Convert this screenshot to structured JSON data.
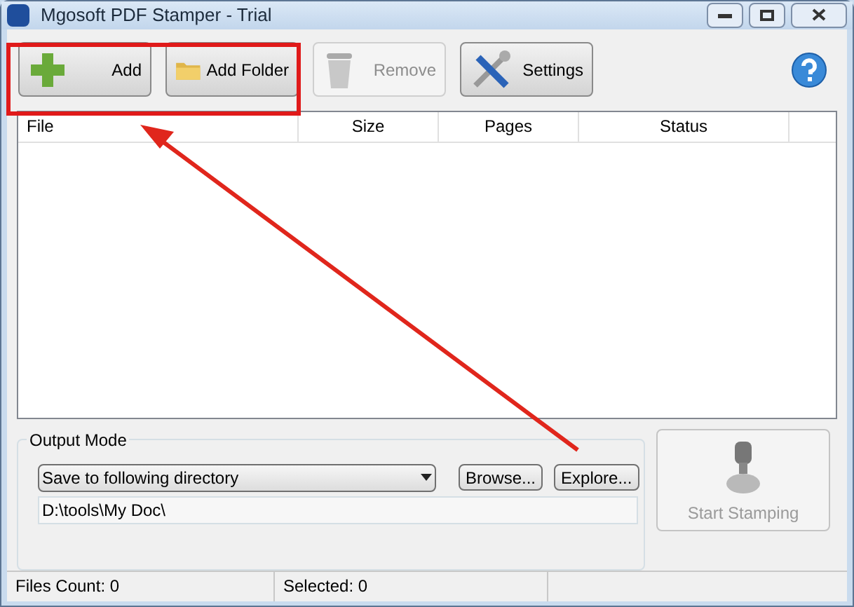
{
  "window": {
    "title": "Mgosoft PDF Stamper - Trial"
  },
  "toolbar": [
    {
      "label": "Add",
      "kind": "add",
      "disabled": false
    },
    {
      "label": "Add Folder",
      "kind": "folder",
      "disabled": false
    },
    {
      "label": "Remove",
      "kind": "remove",
      "disabled": true
    },
    {
      "label": "Settings",
      "kind": "settings",
      "disabled": false
    }
  ],
  "table": {
    "columns": [
      "File",
      "Size",
      "Pages",
      "Status"
    ]
  },
  "output_mode": {
    "title": "Output Mode",
    "mode": "Save to following directory",
    "path": "D:\\tools\\My Doc\\",
    "buttons": [
      "Browse...",
      "Explore..."
    ]
  },
  "start_button": {
    "label": "Start Stamping",
    "disabled": true
  },
  "status_bar": [
    "Files Count: 0",
    "Selected: 0"
  ]
}
